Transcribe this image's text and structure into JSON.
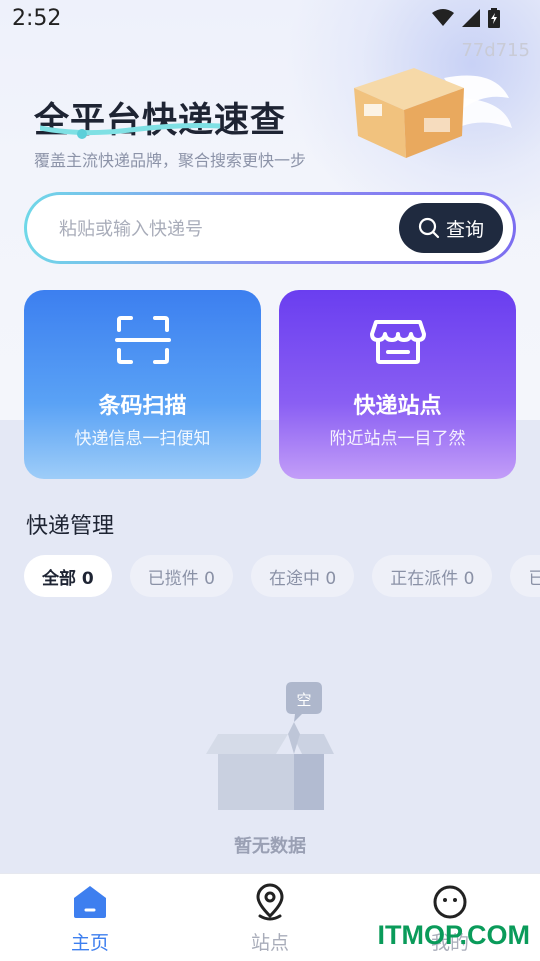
{
  "status_bar": {
    "time": "2:52"
  },
  "build_id": "77d715",
  "hero": {
    "title": "全平台快递速查",
    "subtitle": "覆盖主流快递品牌，聚合搜索更快一步"
  },
  "search": {
    "placeholder": "粘贴或输入快递号",
    "value": "",
    "button_label": "查询"
  },
  "cards": [
    {
      "title": "条码扫描",
      "subtitle": "快递信息一扫便知",
      "icon": "scan-icon"
    },
    {
      "title": "快递站点",
      "subtitle": "附近站点一目了然",
      "icon": "store-icon"
    }
  ],
  "section": {
    "title": "快递管理"
  },
  "tabs": [
    {
      "label": "全部 0",
      "active": true
    },
    {
      "label": "已揽件 0",
      "active": false
    },
    {
      "label": "在途中 0",
      "active": false
    },
    {
      "label": "正在派件 0",
      "active": false
    },
    {
      "label": "已",
      "active": false
    }
  ],
  "empty": {
    "badge": "空",
    "text": "暂无数据"
  },
  "nav": [
    {
      "label": "主页",
      "icon": "home-icon",
      "active": true
    },
    {
      "label": "站点",
      "icon": "location-pin-icon",
      "active": false
    },
    {
      "label": "我的",
      "icon": "smiley-face-icon",
      "active": false
    }
  ],
  "watermark": "ITMOP.COM",
  "colors": {
    "accent": "#3e7fef",
    "scan_card": "#3c7ff0",
    "station_card": "#6a3ef0",
    "search_button": "#1f2a3f"
  }
}
